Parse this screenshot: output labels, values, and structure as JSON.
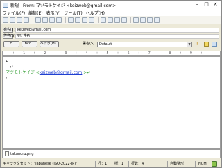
{
  "window": {
    "title": "新規 - From: マツモトケイジ <keizweb@gmail.com>",
    "minimize": "–",
    "maximize": "□",
    "close": "×"
  },
  "menu": [
    "ファイル(F)",
    "編集(E)",
    "表示(V)",
    "ツール(T)",
    "ヘルプ(H)"
  ],
  "headers": {
    "to_label": "宛先(T)",
    "to_value": "keizweb@mail.com",
    "subject_label": "件名(S)",
    "subject_value": "宛: 件名",
    "cc_label": "Cc...",
    "bcc_label": "Bcc...",
    "header_button": "ヘッダ(H)...",
    "signature_label": "署名(S)",
    "signature_value": "Default"
  },
  "ruler": "----+----1----+----2----+----3----+----4----+----5----+----6----+----7----+----8----+----9----+",
  "body": {
    "line1": "↵",
    "line2": "-- ↵",
    "sig_name": "マツモトケイジ <",
    "sig_email": "keizweb@gmail.com",
    "sig_end": " >↵",
    "line4": "↵"
  },
  "attachment": {
    "filename": "takanuru.png"
  },
  "status": {
    "charset": "キャラクタセット：\"Japanese (ISO-2022-JP)\"",
    "line": "行：1",
    "column": "桁：1",
    "line_count": "行数：4",
    "wrap": "自動整形",
    "num": "NUM"
  }
}
